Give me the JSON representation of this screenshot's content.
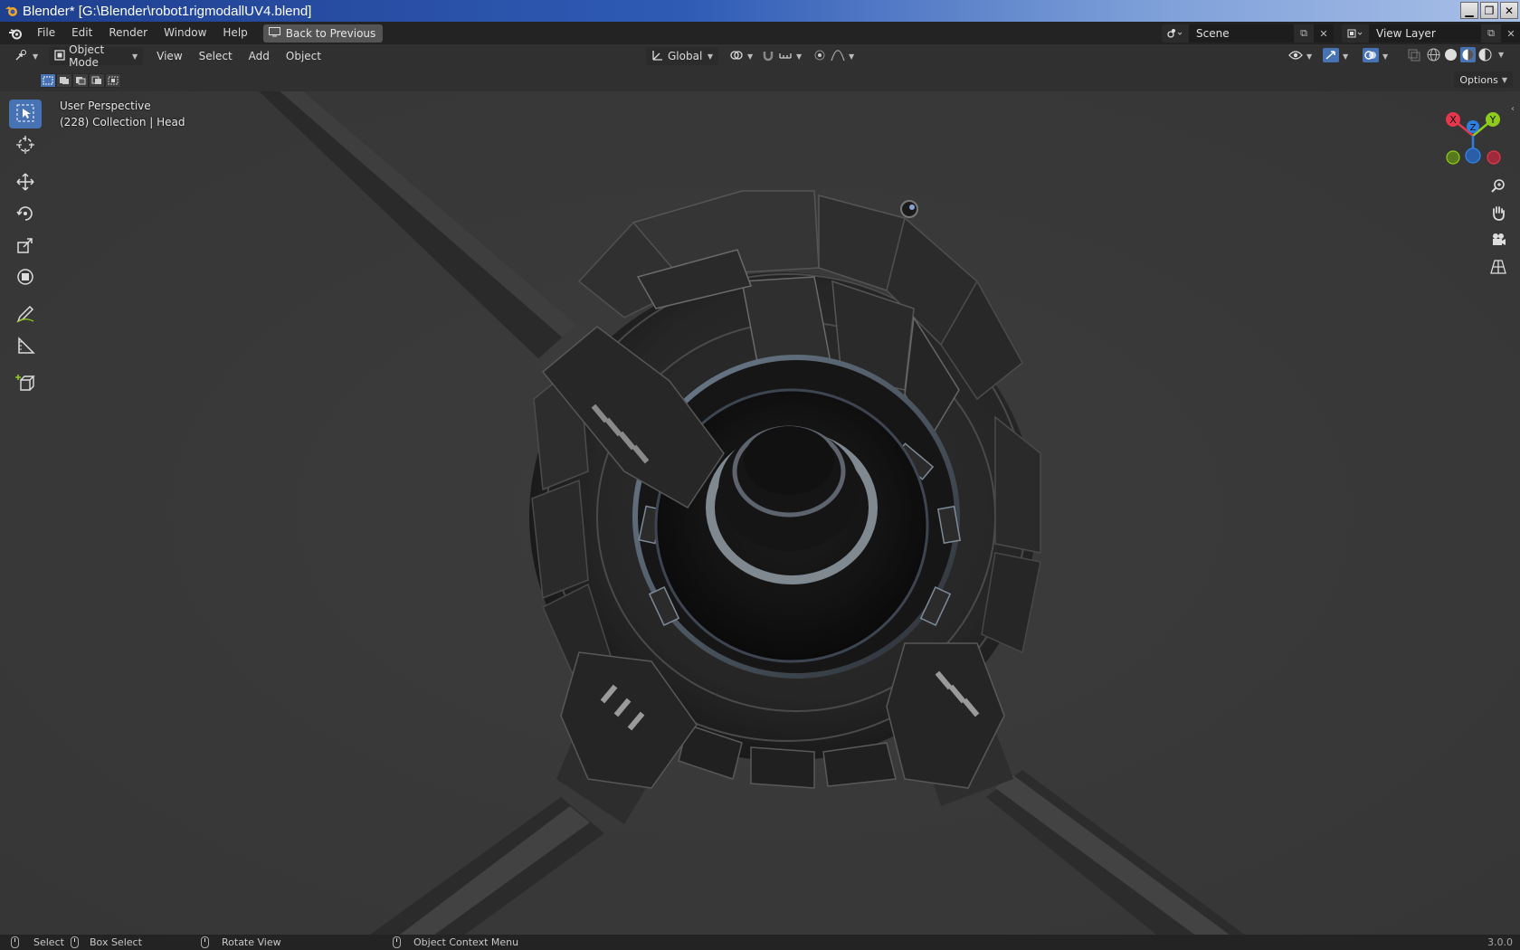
{
  "window": {
    "title": "Blender* [G:\\Blender\\robot1rigmodallUV4.blend]",
    "buttons": [
      "minimize-icon",
      "restore-icon",
      "close-icon"
    ],
    "close_glyph": "✕"
  },
  "menubar": {
    "items": [
      "File",
      "Edit",
      "Render",
      "Window",
      "Help"
    ],
    "back_button": "Back to Previous",
    "scene": "Scene",
    "view_layer": "View Layer"
  },
  "viewport_header": {
    "mode": "Object Mode",
    "menus": [
      "View",
      "Select",
      "Add",
      "Object"
    ],
    "orientation": "Global",
    "options_label": "Options"
  },
  "viewport": {
    "perspective_label": "User Perspective",
    "collection_label": "(228) Collection | Head",
    "gizmo_axes": [
      "X",
      "Y",
      "Z"
    ]
  },
  "statusbar": {
    "items": [
      "Select",
      "Box Select",
      "Rotate View",
      "Object Context Menu"
    ],
    "version": "3.0.0"
  },
  "colors": {
    "accent": "#4772b3",
    "axis_x": "#e5364c",
    "axis_y": "#8fcb1c",
    "axis_z": "#2f7fe0"
  }
}
